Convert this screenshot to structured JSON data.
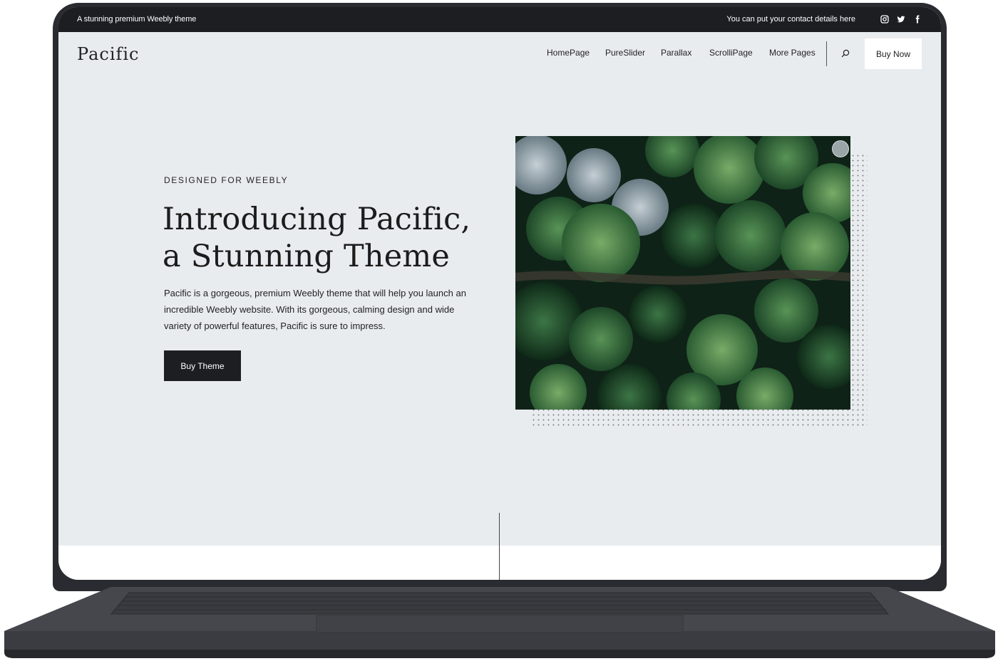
{
  "topbar": {
    "tagline": "A stunning premium Weebly theme",
    "contact": "You can put your contact details here",
    "social_icons": [
      "instagram-icon",
      "twitter-icon",
      "facebook-icon"
    ]
  },
  "header": {
    "logo": "Pacific",
    "nav": [
      "HomePage",
      "PureSlider",
      "Parallax",
      "ScrolliPage",
      "More Pages"
    ],
    "search_icon": "search-icon",
    "cta": "Buy Now"
  },
  "hero": {
    "eyebrow": "DESIGNED FOR WEEBLY",
    "title_line1": "Introducing Pacific,",
    "title_line2": "a Stunning Theme",
    "body": "Pacific is a gorgeous, premium Weebly theme that will help you launch an incredible Weebly website. With its gorgeous, calming design and wide variety of powerful features, Pacific is sure to impress.",
    "button": "Buy Theme"
  },
  "colors": {
    "background": "#e9ecef",
    "topbar": "#1d1e22",
    "button_dark": "#1d1e22",
    "laptop": "#2a2b30"
  }
}
